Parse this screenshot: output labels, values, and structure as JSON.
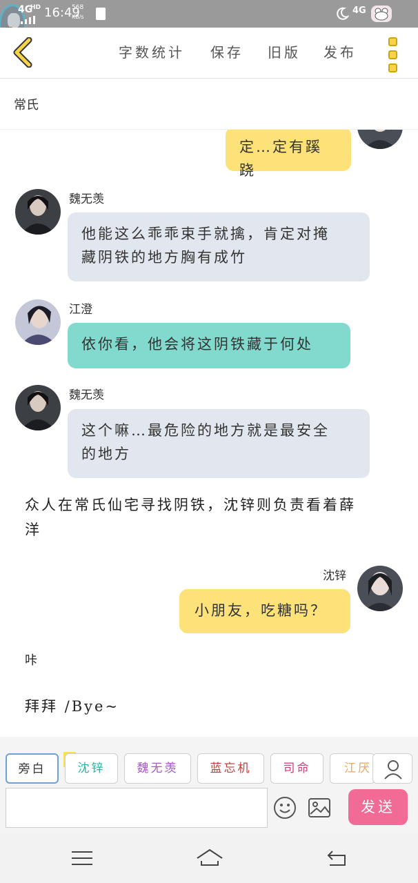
{
  "status_bar": {
    "network_left": "4G",
    "network_hd": "HD",
    "time": "16:49",
    "speed_value": "568",
    "speed_unit": "KB/s",
    "network_right": "4G"
  },
  "header": {
    "items": [
      "字数统计",
      "保存",
      "旧版",
      "发布"
    ]
  },
  "scene": {
    "title": "常氏"
  },
  "messages": [
    {
      "speaker": "",
      "text": "定…定有蹊跷"
    },
    {
      "speaker": "魏无羡",
      "text_lines": [
        "他能这么乖乖束手就擒，肯定对掩",
        "藏阴铁的地方胸有成竹"
      ]
    },
    {
      "speaker": "江澄",
      "text": "依你看，他会将这阴铁藏于何处"
    },
    {
      "speaker": "魏无羡",
      "text_lines": [
        "这个嘛…最危险的地方就是最安全",
        "的地方"
      ]
    },
    {
      "narration_lines": [
        "众人在常氏仙宅寻找阴铁，沈锌则负责看着薛",
        "洋"
      ]
    },
    {
      "speaker": "沈锌",
      "text": "小朋友，吃糖吗？"
    },
    {
      "narration": "咔"
    },
    {
      "narration": "拜拜 /Bye~"
    }
  ],
  "roles": [
    {
      "label": "旁白",
      "color": "#333333"
    },
    {
      "label": "沈锌",
      "color": "#2bb3a2"
    },
    {
      "label": "魏无羡",
      "color": "#a855c8"
    },
    {
      "label": "蓝忘机",
      "color": "#c83b3b"
    },
    {
      "label": "司命",
      "color": "#d63a7a"
    },
    {
      "label": "江厌",
      "color": "#f2a65a"
    }
  ],
  "main_tag": "主",
  "input": {
    "placeholder": ""
  },
  "send_label": "发送",
  "colors": {
    "accent_yellow": "#fde27a",
    "accent_pink": "#f26b97",
    "bubble_grey": "#e2e6ee",
    "bubble_teal": "#82d9cd"
  }
}
